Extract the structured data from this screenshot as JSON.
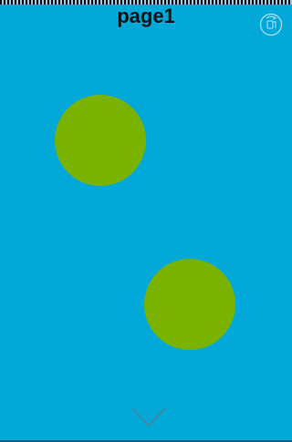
{
  "page": {
    "title": "page1",
    "background_color": "#02a9d8"
  },
  "circles": [
    {
      "color": "#7ab200"
    },
    {
      "color": "#7ab200"
    }
  ],
  "icons": {
    "corner": "rotate-screen-icon",
    "bottom": "chevron-down-icon",
    "icon_color": "#9fd8ec",
    "chevron_color": "#4e7f92"
  }
}
